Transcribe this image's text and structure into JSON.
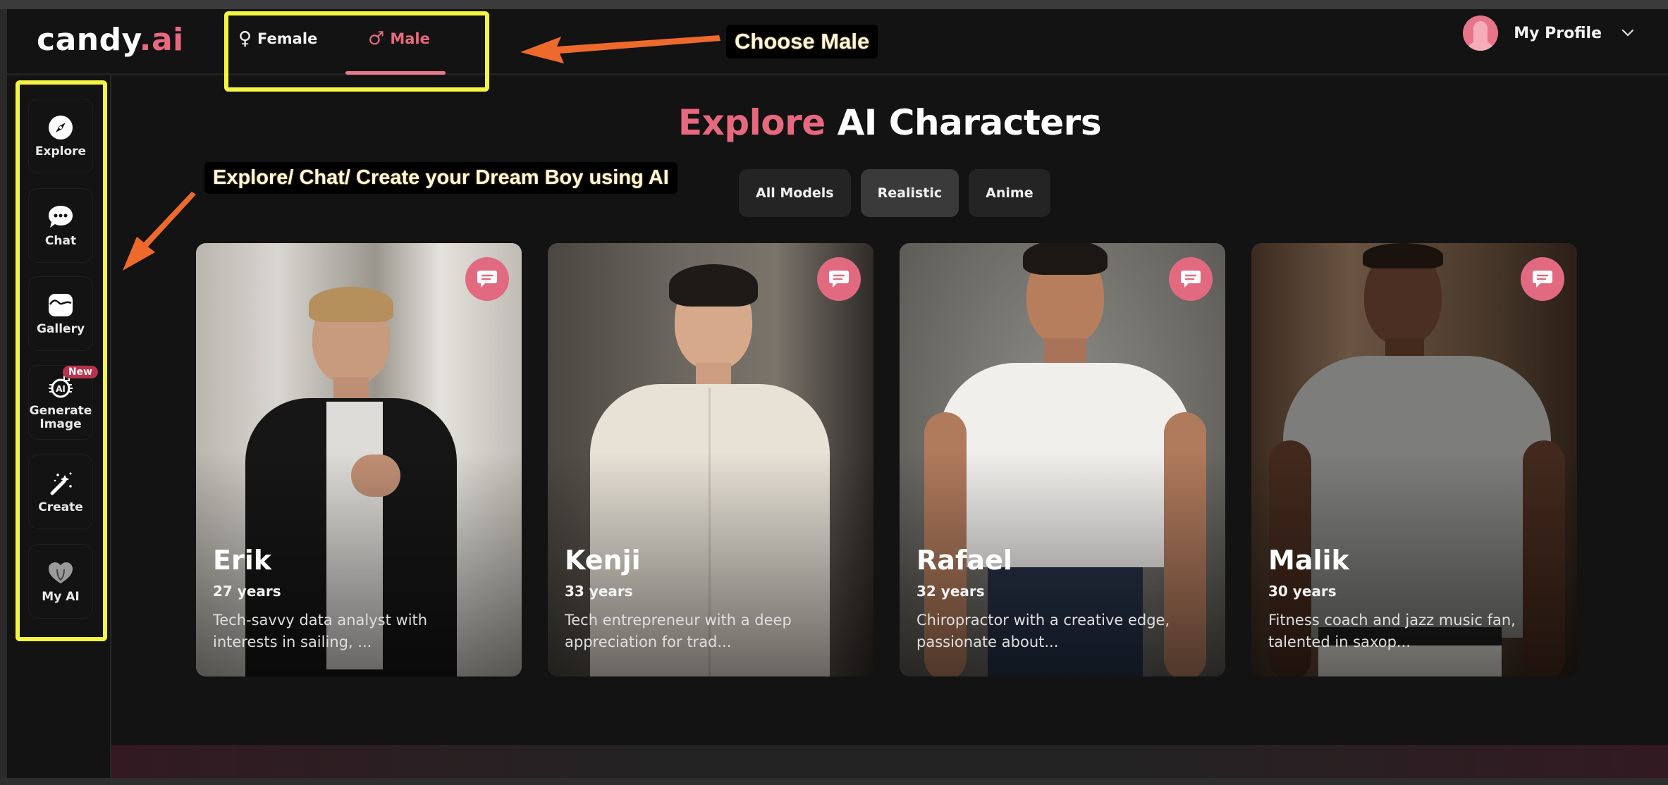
{
  "app": {
    "logo_main": "candy",
    "logo_accent": ".ai"
  },
  "header": {
    "gender_tabs": [
      {
        "label": "Female",
        "symbol": "♀",
        "active": false
      },
      {
        "label": "Male",
        "symbol": "♂",
        "active": true
      }
    ],
    "profile_label": "My Profile",
    "profile_chevron": "⌄"
  },
  "sidebar": {
    "items": [
      {
        "label": "Explore",
        "icon": "compass-icon"
      },
      {
        "label": "Chat",
        "icon": "chat-bubble-icon"
      },
      {
        "label": "Gallery",
        "icon": "image-icon"
      },
      {
        "label": "Generate Image",
        "icon": "ai-camera-icon",
        "badge": "New"
      },
      {
        "label": "Create",
        "icon": "magic-wand-icon"
      },
      {
        "label": "My AI",
        "icon": "heart-icon"
      }
    ]
  },
  "main": {
    "title_accent": "Explore",
    "title_rest": " AI Characters",
    "filters": [
      {
        "label": "All Models",
        "active": false
      },
      {
        "label": "Realistic",
        "active": true
      },
      {
        "label": "Anime",
        "active": false
      }
    ],
    "characters": [
      {
        "name": "Erik",
        "age": "27 years",
        "description": "Tech-savvy data analyst with interests in sailing, ..."
      },
      {
        "name": "Kenji",
        "age": "33 years",
        "description": "Tech entrepreneur with a deep appreciation for trad..."
      },
      {
        "name": "Rafael",
        "age": "32 years",
        "description": "Chiropractor with a creative edge, passionate about..."
      },
      {
        "name": "Malik",
        "age": "30 years",
        "description": "Fitness coach and jazz music fan, talented in saxop..."
      }
    ]
  },
  "annotations": {
    "choose_male": "Choose Male",
    "sidebar_hint": "Explore/ Chat/ Create your Dream Boy using AI"
  },
  "colors": {
    "accent": "#e8697e",
    "background": "#131313",
    "annotation_yellow": "#f5f542",
    "annotation_arrow": "#ee6a2c",
    "badge": "#b7334d"
  }
}
